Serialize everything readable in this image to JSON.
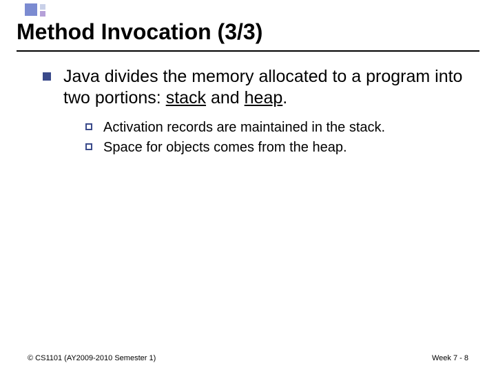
{
  "title": "Method Invocation (3/3)",
  "body": {
    "point1": {
      "pre": "Java divides the memory allocated to a program into two portions: ",
      "u1": "stack",
      "mid": " and ",
      "u2": "heap",
      "post": "."
    },
    "sub1": "Activation records are maintained in the stack.",
    "sub2": "Space for objects comes from the heap."
  },
  "footer": {
    "left": "© CS1101 (AY2009-2010 Semester 1)",
    "right": "Week 7 - 8"
  }
}
